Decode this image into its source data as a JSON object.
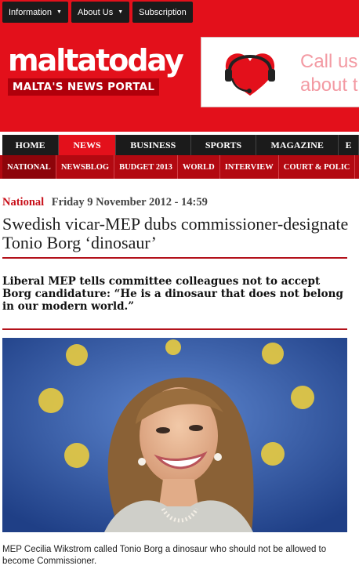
{
  "topnav": [
    {
      "label": "Information",
      "dropdown": true
    },
    {
      "label": "About Us",
      "dropdown": true
    },
    {
      "label": "Subscription",
      "dropdown": false
    }
  ],
  "logo": {
    "brand": "maltatoday",
    "tagline": "MALTA'S NEWS PORTAL"
  },
  "ad": {
    "text_line1": "Call us",
    "text_line2": "about t"
  },
  "mainnav": [
    "HOME",
    "NEWS",
    "BUSINESS",
    "SPORTS",
    "MAGAZINE",
    "E"
  ],
  "subnav": [
    "NATIONAL",
    "NEWSBLOG",
    "BUDGET 2013",
    "WORLD",
    "INTERVIEW",
    "COURT & POLIC"
  ],
  "article": {
    "category": "National",
    "date": "Friday 9 November 2012 - 14:59",
    "title": "Swedish vicar-MEP dubs commissioner-designate Tonio Borg ‘dinosaur’",
    "standfirst": "Liberal MEP tells committee colleagues not to accept Borg candidature: “He is a dinosaur that does not belong in our modern world.”",
    "caption": "MEP Cecilia Wikstrom called Tonio Borg a dinosaur who should not be allowed to become Commissioner."
  },
  "colors": {
    "brand_red": "#e3101b",
    "dark_red": "#b30911",
    "nav_dark": "#1b1b1b",
    "eu_blue": "#2f5fb0",
    "eu_star": "#f3d23a"
  }
}
